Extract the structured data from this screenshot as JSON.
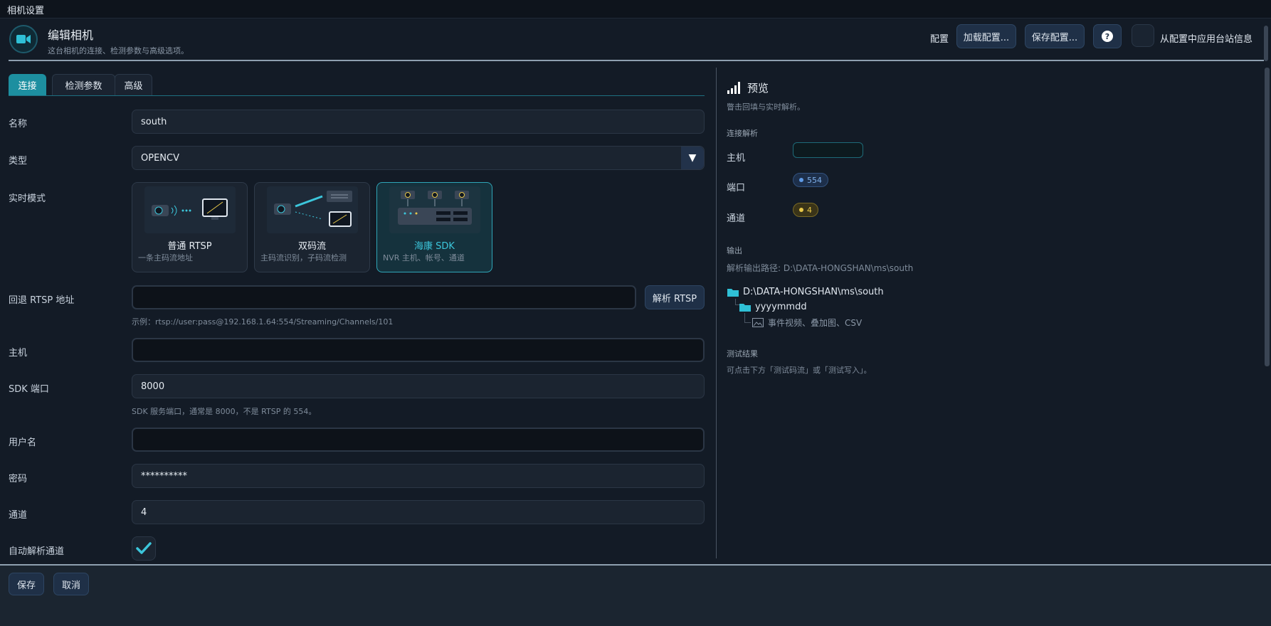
{
  "window": {
    "title": "相机设置"
  },
  "header": {
    "title": "编辑相机",
    "subtitle": "这台相机的连接、检测参数与高级选项。",
    "config_label": "配置",
    "load_button": "加载配置...",
    "save_button": "保存配置...",
    "help_icon": "?",
    "apply_label": "从配置中应用台站信息"
  },
  "tabs": [
    {
      "label": "连接",
      "active": true
    },
    {
      "label": "检测参数",
      "active": false
    },
    {
      "label": "高级",
      "active": false
    }
  ],
  "form": {
    "name_label": "名称",
    "name_value": "south",
    "type_label": "类型",
    "type_value": "OPENCV",
    "type_arrow": "▼",
    "mode_label": "实时模式",
    "modes": [
      {
        "title": "普通 RTSP",
        "desc": "一条主码流地址"
      },
      {
        "title": "双码流",
        "desc": "主码流识别，子码流检测"
      },
      {
        "title": "海康 SDK",
        "desc": "NVR 主机、帐号、通道"
      }
    ],
    "fallback_label": "回退 RTSP 地址",
    "fallback_value": "",
    "fallback_hint": "示例：rtsp://user:pass@192.168.1.64:554/Streaming/Channels/101",
    "parse_button": "解析 RTSP",
    "host_label": "主机",
    "host_value": "",
    "sdk_port_label": "SDK 端口",
    "sdk_port_value": "8000",
    "sdk_port_hint": "SDK 服务端口，通常是 8000，不是 RTSP 的 554。",
    "username_label": "用户名",
    "username_value": "",
    "password_label": "密码",
    "password_value": "**********",
    "channel_label": "通道",
    "channel_value": "4",
    "auto_parse_label": "自动解析通道",
    "auto_parse_checked": true
  },
  "preview": {
    "title": "预览",
    "subtitle": "瞥击回填与实时解析。",
    "conn_section": "连接解析",
    "host_label": "主机",
    "port_label": "端口",
    "port_value": "554",
    "channel_label": "通道",
    "channel_value": "4",
    "output_section": "输出",
    "output_path": "解析输出路径: D:\\DATA-HONGSHAN\\ms\\south",
    "tree_root": "D:\\DATA-HONGSHAN\\ms\\south",
    "tree_child": "yyyymmdd",
    "tree_leaf": "事件视频、叠加图、CSV",
    "test_section": "测试结果",
    "test_note": "可点击下方「测试码流」或「测试写入」。"
  },
  "footer": {
    "save_button": "保存",
    "cancel_button": "取消"
  },
  "colors": {
    "accent": "#1d8fa0",
    "background": "#131b26",
    "panel": "#1b2430"
  }
}
